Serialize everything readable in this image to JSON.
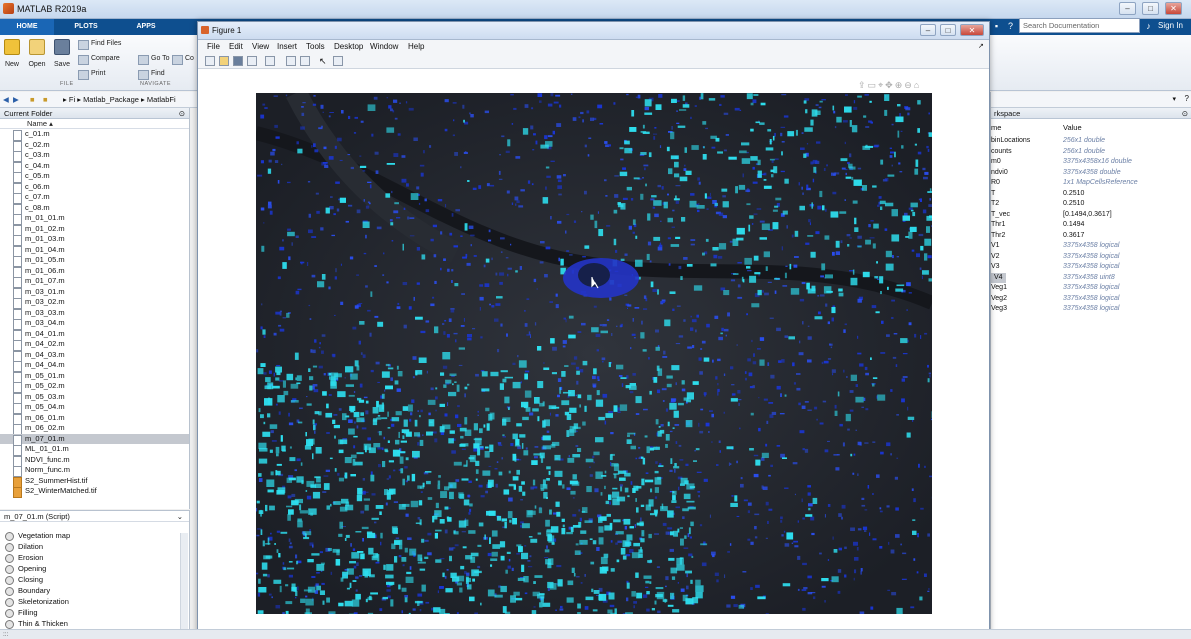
{
  "app": {
    "title": "MATLAB R2019a",
    "window_buttons": [
      "–",
      "□",
      "✕"
    ],
    "sign_in": "Sign In",
    "search_placeholder": "Search Documentation"
  },
  "ribbon": {
    "tabs": [
      "HOME",
      "PLOTS",
      "APPS"
    ],
    "file_group": "FILE",
    "navigate_group": "NAVIGATE",
    "buttons": {
      "new": "New",
      "open": "Open",
      "save": "Save",
      "find_files": "Find Files",
      "compare": "Compare",
      "print": "Print",
      "go_to": "Go To",
      "find": "Find",
      "comment": "Co"
    }
  },
  "address": {
    "crumbs": [
      "Fi",
      "Matlab_Package",
      "MatlabFi"
    ]
  },
  "current_folder": {
    "title": "Current Folder",
    "column_name": "Name",
    "files": [
      {
        "name": "c_01.m",
        "type": "m"
      },
      {
        "name": "c_02.m",
        "type": "m"
      },
      {
        "name": "c_03.m",
        "type": "m"
      },
      {
        "name": "c_04.m",
        "type": "m"
      },
      {
        "name": "c_05.m",
        "type": "m"
      },
      {
        "name": "c_06.m",
        "type": "m"
      },
      {
        "name": "c_07.m",
        "type": "m"
      },
      {
        "name": "c_08.m",
        "type": "m"
      },
      {
        "name": "m_01_01.m",
        "type": "m"
      },
      {
        "name": "m_01_02.m",
        "type": "m"
      },
      {
        "name": "m_01_03.m",
        "type": "m"
      },
      {
        "name": "m_01_04.m",
        "type": "m"
      },
      {
        "name": "m_01_05.m",
        "type": "m"
      },
      {
        "name": "m_01_06.m",
        "type": "m"
      },
      {
        "name": "m_01_07.m",
        "type": "m"
      },
      {
        "name": "m_03_01.m",
        "type": "m"
      },
      {
        "name": "m_03_02.m",
        "type": "m"
      },
      {
        "name": "m_03_03.m",
        "type": "m"
      },
      {
        "name": "m_03_04.m",
        "type": "m"
      },
      {
        "name": "m_04_01.m",
        "type": "m"
      },
      {
        "name": "m_04_02.m",
        "type": "m"
      },
      {
        "name": "m_04_03.m",
        "type": "m"
      },
      {
        "name": "m_04_04.m",
        "type": "m"
      },
      {
        "name": "m_05_01.m",
        "type": "m"
      },
      {
        "name": "m_05_02.m",
        "type": "m"
      },
      {
        "name": "m_05_03.m",
        "type": "m"
      },
      {
        "name": "m_05_04.m",
        "type": "m"
      },
      {
        "name": "m_06_01.m",
        "type": "m"
      },
      {
        "name": "m_06_02.m",
        "type": "m"
      },
      {
        "name": "m_07_01.m",
        "type": "m",
        "selected": true
      },
      {
        "name": "ML_01_01.m",
        "type": "m"
      },
      {
        "name": "NDVI_func.m",
        "type": "m"
      },
      {
        "name": "Norm_func.m",
        "type": "m"
      },
      {
        "name": "S2_SummerHist.tif",
        "type": "tif"
      },
      {
        "name": "S2_WinterMatched.tif",
        "type": "tif"
      }
    ]
  },
  "details": {
    "title": "m_07_01.m  (Script)",
    "sections": [
      "Vegetation map",
      "Dilation",
      "Erosion",
      "Opening",
      "Closing",
      "Boundary",
      "Skeletonization",
      "Filling",
      "Thin & Thicken"
    ]
  },
  "figure": {
    "title": "Figure 1",
    "menu": [
      "File",
      "Edit",
      "View",
      "Insert",
      "Tools",
      "Desktop",
      "Window",
      "Help"
    ],
    "window_buttons": [
      "–",
      "□",
      "✕"
    ]
  },
  "workspace": {
    "title": "rkspace",
    "col_name": "me",
    "col_value": "Value",
    "rows": [
      {
        "name": "binLocations",
        "value": "256x1 double",
        "dim": true
      },
      {
        "name": "counts",
        "value": "256x1 double",
        "dim": true
      },
      {
        "name": "m0",
        "value": "3375x4358x16 double",
        "dim": true
      },
      {
        "name": "ndvi0",
        "value": "3375x4358 double",
        "dim": true
      },
      {
        "name": "R0",
        "value": "1x1 MapCellsReference",
        "dim": true
      },
      {
        "name": "T",
        "value": "0.2510",
        "dim": false
      },
      {
        "name": "T2",
        "value": "0.2510",
        "dim": false
      },
      {
        "name": "T_vec",
        "value": "[0.1494,0.3617]",
        "dim": false
      },
      {
        "name": "Thr1",
        "value": "0.1494",
        "dim": false
      },
      {
        "name": "Thr2",
        "value": "0.3617",
        "dim": false
      },
      {
        "name": "V1",
        "value": "3375x4358 logical",
        "dim": true
      },
      {
        "name": "V2",
        "value": "3375x4358 logical",
        "dim": true
      },
      {
        "name": "V3",
        "value": "3375x4358 logical",
        "dim": true
      },
      {
        "name": "V4",
        "value": "3375x4358 uint8",
        "dim": true,
        "selected": true
      },
      {
        "name": "Veg1",
        "value": "3375x4358 logical",
        "dim": true
      },
      {
        "name": "Veg2",
        "value": "3375x4358 logical",
        "dim": true
      },
      {
        "name": "Veg3",
        "value": "3375x4358 logical",
        "dim": true
      }
    ]
  },
  "colors": {
    "tab_bar": "#0e4f8f",
    "map_dark": "#1e2128",
    "map_blue": "#1a36d8",
    "map_cyan": "#2ee0f0"
  }
}
